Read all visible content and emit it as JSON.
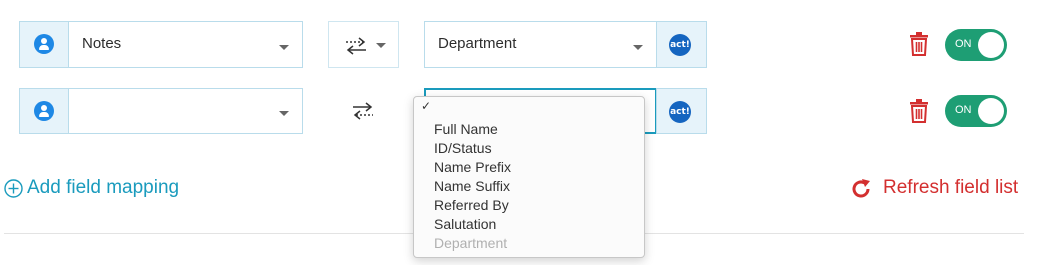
{
  "rows": [
    {
      "source_field": "Notes",
      "target_field": "Department",
      "target_logo": "act!",
      "toggle_label": "ON"
    },
    {
      "source_field": "",
      "target_field": "",
      "target_logo": "act!",
      "toggle_label": "ON"
    }
  ],
  "dropdown": {
    "items": [
      {
        "label": "Full Name",
        "disabled": false
      },
      {
        "label": "ID/Status",
        "disabled": false
      },
      {
        "label": "Name Prefix",
        "disabled": false
      },
      {
        "label": "Name Suffix",
        "disabled": false
      },
      {
        "label": "Referred By",
        "disabled": false
      },
      {
        "label": "Salutation",
        "disabled": false
      },
      {
        "label": "Department",
        "disabled": true
      }
    ],
    "checkmark": "✓"
  },
  "actions": {
    "add_label": "Add field mapping",
    "refresh_label": "Refresh field list"
  },
  "icons": {
    "user": "user-circle-icon",
    "direction": "bidirectional-arrows-icon",
    "trash": "trash-icon",
    "add": "plus-circle-icon",
    "refresh": "refresh-icon"
  },
  "colors": {
    "accent": "#1a9bbd",
    "danger": "#d32f2f",
    "toggle_on": "#1e9e74"
  }
}
